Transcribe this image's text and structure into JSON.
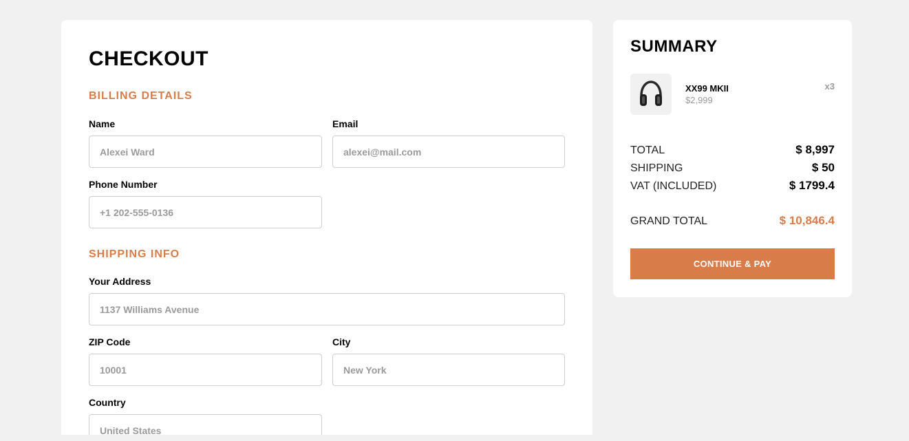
{
  "checkout": {
    "title": "CHECKOUT",
    "billing": {
      "section_title": "BILLING DETAILS",
      "name_label": "Name",
      "name_placeholder": "Alexei Ward",
      "email_label": "Email",
      "email_placeholder": "alexei@mail.com",
      "phone_label": "Phone Number",
      "phone_placeholder": "+1 202-555-0136"
    },
    "shipping": {
      "section_title": "SHIPPING INFO",
      "address_label": "Your Address",
      "address_placeholder": "1137 Williams Avenue",
      "zip_label": "ZIP Code",
      "zip_placeholder": "10001",
      "city_label": "City",
      "city_placeholder": "New York",
      "country_label": "Country",
      "country_placeholder": "United States"
    }
  },
  "summary": {
    "title": "SUMMARY",
    "item": {
      "name": "XX99 MKII",
      "price": "$2,999",
      "quantity": "x3",
      "icon": "headphones-icon"
    },
    "rows": [
      {
        "label": "TOTAL",
        "value": "$ 8,997"
      },
      {
        "label": "SHIPPING",
        "value": "$ 50"
      },
      {
        "label": "VAT (INCLUDED)",
        "value": "$ 1799.4"
      }
    ],
    "grand_total": {
      "label": "GRAND TOTAL",
      "value": "$ 10,846.4"
    },
    "pay_button": "CONTINUE & PAY"
  },
  "colors": {
    "accent": "#d87d4a",
    "background": "#f1f1f1"
  }
}
